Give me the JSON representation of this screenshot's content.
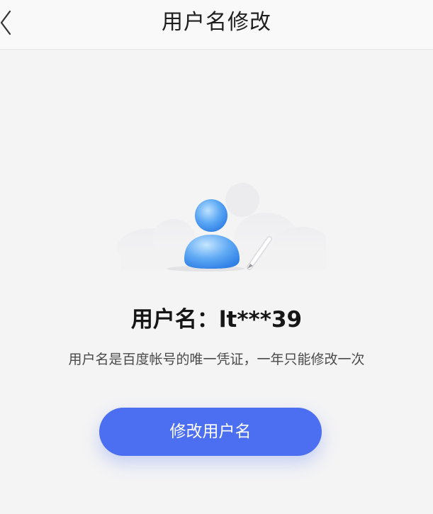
{
  "header": {
    "title": "用户名修改",
    "back_icon": "chevron-left-icon"
  },
  "illustration": {
    "icon": "user-edit-illustration"
  },
  "profile": {
    "username_line": "用户名：lt***39",
    "description": "用户名是百度帐号的唯一凭证，一年只能修改一次"
  },
  "actions": {
    "modify_label": "修改用户名"
  },
  "colors": {
    "accent": "#4b6ff0",
    "background": "#f4f4f5",
    "header_bg": "#f9f9fa"
  }
}
